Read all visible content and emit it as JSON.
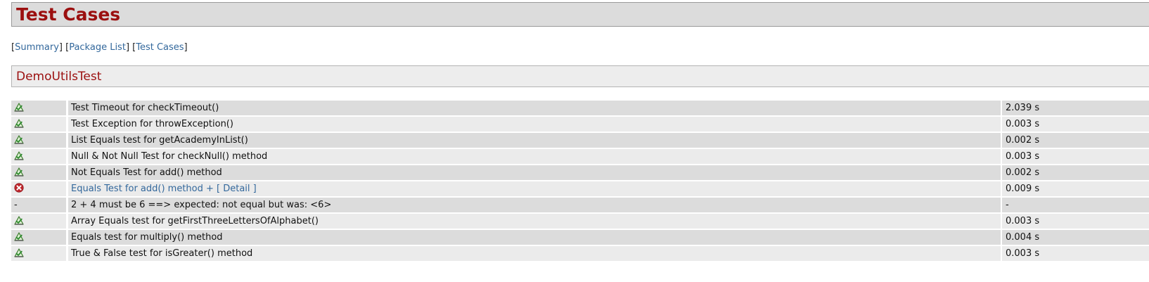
{
  "header": {
    "title": "Test Cases"
  },
  "nav": {
    "items": [
      "Summary",
      "Package List",
      "Test Cases"
    ]
  },
  "section": {
    "title": "DemoUtilsTest"
  },
  "tests": [
    {
      "status": "pass",
      "name": "Test Timeout for checkTimeout()",
      "time": "2.039 s"
    },
    {
      "status": "pass",
      "name": "Test Exception for throwException()",
      "time": "0.003 s"
    },
    {
      "status": "pass",
      "name": "List Equals test for getAcademyInList()",
      "time": "0.002 s"
    },
    {
      "status": "pass",
      "name": "Null & Not Null Test for checkNull() method",
      "time": "0.003 s"
    },
    {
      "status": "pass",
      "name": "Not Equals Test for add() method",
      "time": "0.002 s"
    },
    {
      "status": "fail",
      "name": "Equals Test for add() method + [ Detail ]",
      "time": "0.009 s"
    },
    {
      "status": "detail",
      "status_text": "-",
      "name": "2 + 4 must be 6 ==> expected: not equal but was: <6>",
      "time": "-"
    },
    {
      "status": "pass",
      "name": "Array Equals test for getFirstThreeLettersOfAlphabet()",
      "time": "0.003 s"
    },
    {
      "status": "pass",
      "name": "Equals test for multiply() method",
      "time": "0.004 s"
    },
    {
      "status": "pass",
      "name": "True & False test for isGreater() method",
      "time": "0.003 s"
    }
  ],
  "colors": {
    "title": "#9b0f0f",
    "link": "#33689c",
    "pass_icon": "#3a9a3a",
    "fail_icon": "#c0272d"
  }
}
